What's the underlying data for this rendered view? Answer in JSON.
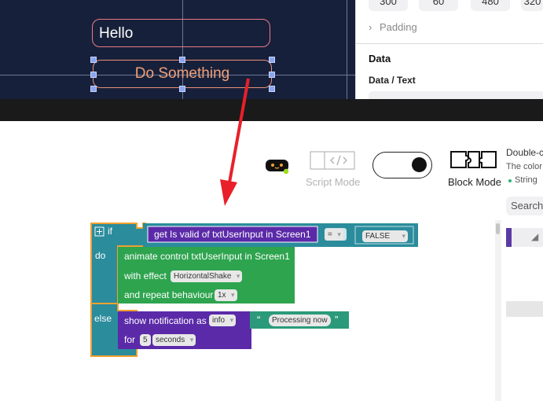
{
  "canvas": {
    "hello_text": "Hello",
    "button_text": "Do Something"
  },
  "props": {
    "numbers": [
      "300",
      "60",
      "480",
      "320"
    ],
    "padding_label": "Padding",
    "data_title": "Data",
    "data_text_label": "Data / Text"
  },
  "toolbar": {
    "script_mode_label": "Script Mode",
    "block_mode_label": "Block Mode",
    "mode_state": "block"
  },
  "hint": {
    "title": "Double-c",
    "color_line": "The color",
    "string_line": "String"
  },
  "palette": {
    "search_placeholder": "Search"
  },
  "blocks": {
    "if_label": "if",
    "do_label": "do",
    "else_label": "else",
    "condition": {
      "get_label": "get",
      "property": "Is valid",
      "of_label": "of",
      "component": "txtUserInput",
      "in_label": "in",
      "screen": "Screen1",
      "operator": "=",
      "value": "FALSE"
    },
    "animate": {
      "text": "animate control txtUserInput in Screen1",
      "with_effect_label": "with effect",
      "effect": "HorizontalShake",
      "repeat_label": "and repeat behaviour",
      "repeat_value": "1x"
    },
    "notification": {
      "label": "show notification as",
      "type": "info",
      "for_label": "for",
      "duration": "5",
      "unit": "seconds",
      "message": "Processing now",
      "open_quote": "“",
      "close_quote": "”"
    }
  },
  "colors": {
    "canvas_bg": "#17203a",
    "accent_red": "#e8202a",
    "control_block": "#2b8c9c",
    "action_block": "#2ea44f",
    "notify_block": "#5b2aa8",
    "text_block": "#2b9a7a",
    "highlight_orange": "#f0a030"
  },
  "icons": [
    "robot-icon",
    "code-icon",
    "puzzle-icon",
    "chevron-right-icon",
    "plus-icon"
  ]
}
